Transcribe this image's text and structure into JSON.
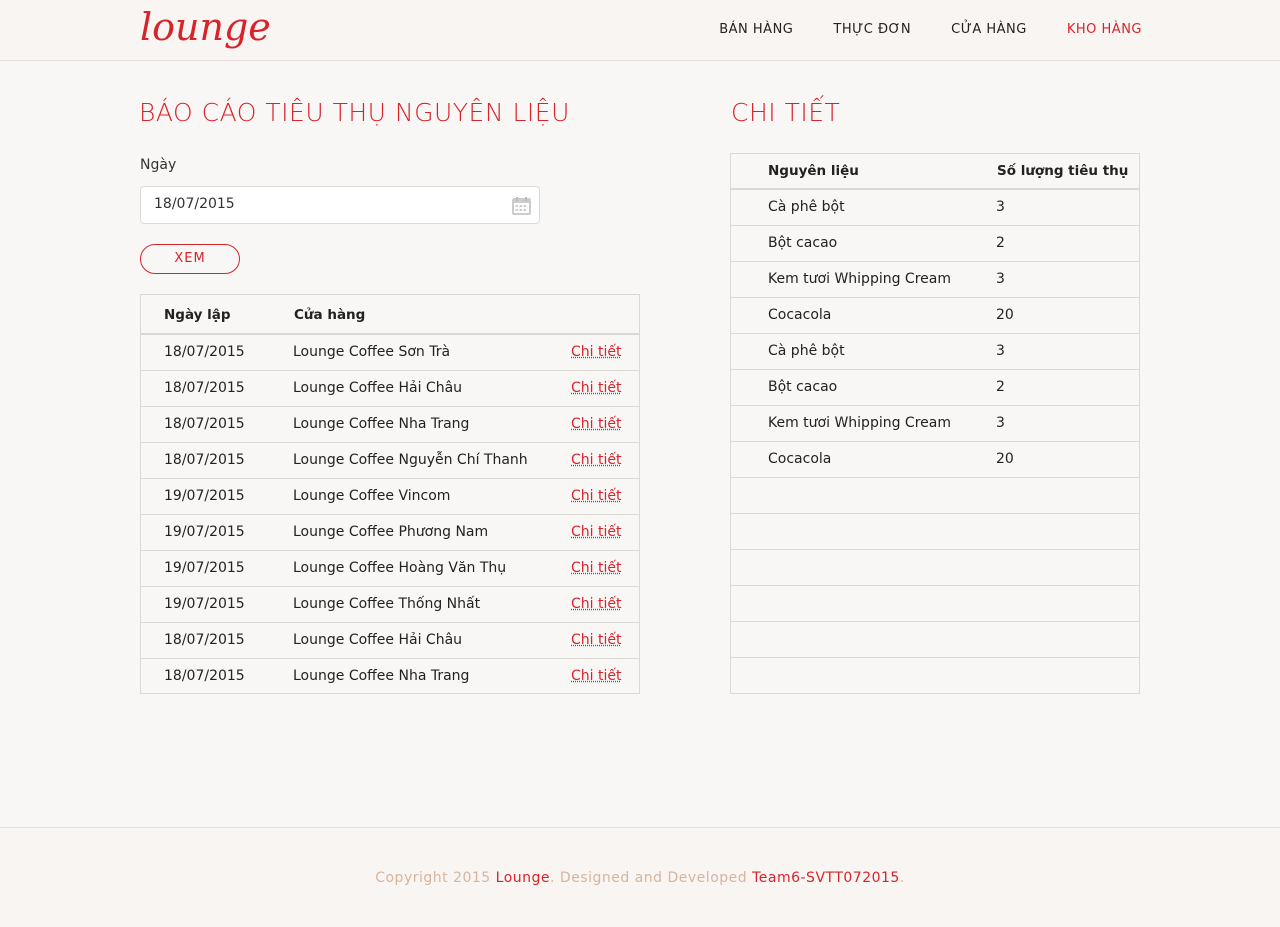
{
  "brand": {
    "logo": "lounge"
  },
  "nav": {
    "items": [
      {
        "label": "BÁN HÀNG",
        "active": false
      },
      {
        "label": "THỰC ĐƠN",
        "active": false
      },
      {
        "label": "CỬA HÀNG",
        "active": false
      },
      {
        "label": "KHO HÀNG",
        "active": true
      }
    ]
  },
  "report": {
    "title": "BÁO CÁO TIÊU THỤ NGUYÊN LIỆU",
    "date_label": "Ngày",
    "date_value": "18/07/2015",
    "view_button": "XEM",
    "columns": {
      "date": "Ngày lập",
      "store": "Cửa hàng"
    },
    "rows": [
      {
        "date": "18/07/2015",
        "store": "Lounge Coffee Sơn Trà",
        "link": "Chi tiết"
      },
      {
        "date": "18/07/2015",
        "store": "Lounge Coffee Hải Châu",
        "link": "Chi tiết"
      },
      {
        "date": "18/07/2015",
        "store": "Lounge Coffee Nha Trang",
        "link": "Chi tiết"
      },
      {
        "date": "18/07/2015",
        "store": "Lounge Coffee Nguyễn Chí Thanh",
        "link": "Chi tiết"
      },
      {
        "date": "19/07/2015",
        "store": "Lounge Coffee Vincom",
        "link": "Chi tiết"
      },
      {
        "date": "19/07/2015",
        "store": "Lounge Coffee Phương Nam",
        "link": "Chi tiết"
      },
      {
        "date": "19/07/2015",
        "store": "Lounge Coffee Hoàng Văn Thụ",
        "link": "Chi tiết"
      },
      {
        "date": "19/07/2015",
        "store": "Lounge Coffee Thống Nhất",
        "link": "Chi tiết"
      },
      {
        "date": "18/07/2015",
        "store": "Lounge Coffee Hải Châu",
        "link": "Chi tiết"
      },
      {
        "date": "18/07/2015",
        "store": "Lounge Coffee Nha Trang",
        "link": "Chi tiết"
      }
    ]
  },
  "detail": {
    "title": "CHI TIẾT",
    "columns": {
      "ingredient": "Nguyên liệu",
      "quantity": "Số lượng tiêu thụ"
    },
    "rows": [
      {
        "ingredient": "Cà phê bột",
        "quantity": "3"
      },
      {
        "ingredient": "Bột cacao",
        "quantity": "2"
      },
      {
        "ingredient": "Kem tươi Whipping Cream",
        "quantity": "3"
      },
      {
        "ingredient": "Cocacola",
        "quantity": "20"
      },
      {
        "ingredient": "Cà phê bột",
        "quantity": "3"
      },
      {
        "ingredient": "Bột cacao",
        "quantity": "2"
      },
      {
        "ingredient": "Kem tươi Whipping Cream",
        "quantity": "3"
      },
      {
        "ingredient": "Cocacola",
        "quantity": "20"
      },
      {
        "ingredient": "",
        "quantity": ""
      },
      {
        "ingredient": "",
        "quantity": ""
      },
      {
        "ingredient": "",
        "quantity": ""
      },
      {
        "ingredient": "",
        "quantity": ""
      },
      {
        "ingredient": "",
        "quantity": ""
      },
      {
        "ingredient": "",
        "quantity": ""
      }
    ]
  },
  "footer": {
    "prefix": "Copyright 2015 ",
    "brand_link": "Lounge",
    "middle": ". Designed and Developed ",
    "team_link": "Team6-SVTT072015",
    "suffix": "."
  },
  "colors": {
    "accent": "#d8232a",
    "footer_text": "#d9b49d",
    "background": "#f9f7f5"
  }
}
